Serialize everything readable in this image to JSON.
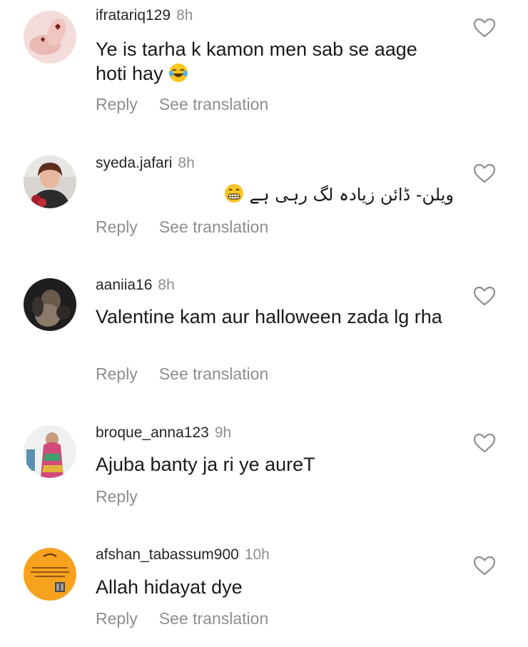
{
  "comments": [
    {
      "username": "ifratariq129",
      "time": "8h",
      "text": "Ye is tarha k kamon men sab se aage hoti hay",
      "emoji": "laughing-tears-emoji",
      "reply_label": "Reply",
      "translation_label": "See translation"
    },
    {
      "username": "syeda.jafari",
      "time": "8h",
      "text": "ویلن- ڈائن زیادہ لگ رہی ہے",
      "emoji": "grimacing-emoji",
      "reply_label": "Reply",
      "translation_label": "See translation"
    },
    {
      "username": "aaniia16",
      "time": "8h",
      "text": "Valentine kam aur halloween zada lg rha",
      "reply_label": "Reply",
      "translation_label": "See translation"
    },
    {
      "username": "broque_anna123",
      "time": "9h",
      "text": "Ajuba banty ja ri ye aureT",
      "reply_label": "Reply"
    },
    {
      "username": "afshan_tabassum900",
      "time": "10h",
      "text": "Allah hidayat dye",
      "reply_label": "Reply",
      "translation_label": "See translation"
    }
  ],
  "icons": {
    "like": "heart-outline-icon"
  },
  "colors": {
    "username": "#262626",
    "meta": "#8e8e8e",
    "text": "#1a1a1a"
  }
}
